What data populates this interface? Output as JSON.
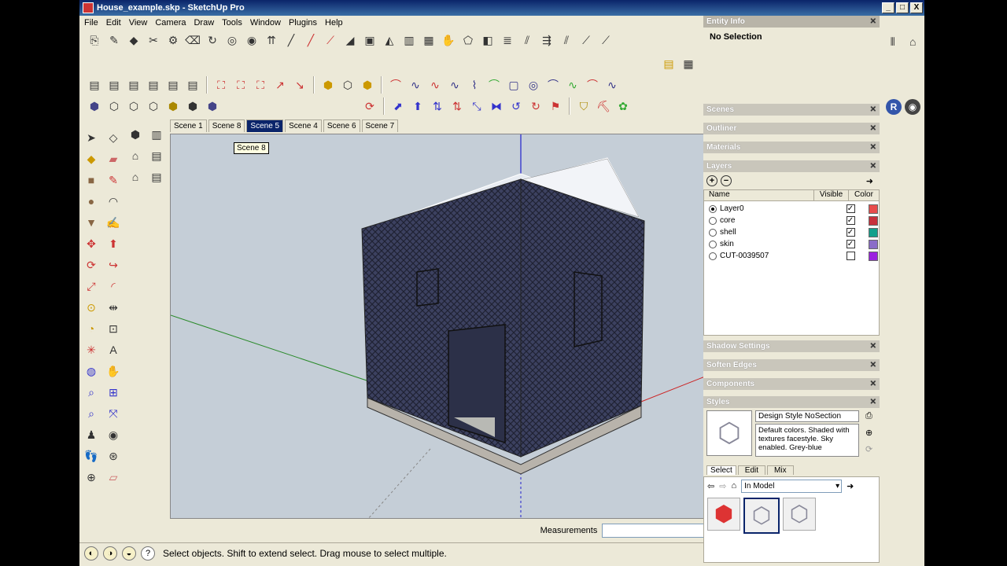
{
  "window": {
    "title": "House_example.skp - SketchUp Pro",
    "min": "_",
    "max": "□",
    "close": "X"
  },
  "menu": [
    "File",
    "Edit",
    "View",
    "Camera",
    "Draw",
    "Tools",
    "Window",
    "Plugins",
    "Help"
  ],
  "scene_tabs": [
    {
      "label": "Scene 1",
      "active": false
    },
    {
      "label": "Scene 8",
      "active": false
    },
    {
      "label": "Scene 5",
      "active": true
    },
    {
      "label": "Scene 4",
      "active": false
    },
    {
      "label": "Scene 6",
      "active": false
    },
    {
      "label": "Scene 7",
      "active": false
    }
  ],
  "tooltip": "Scene 8",
  "measurements_label": "Measurements",
  "status_text": "Select objects. Shift to extend select. Drag mouse to select multiple.",
  "entity_info": {
    "title": "Entity Info",
    "value": "No Selection"
  },
  "trays": {
    "scenes": "Scenes",
    "outliner": "Outliner",
    "materials": "Materials",
    "layers": "Layers",
    "shadow": "Shadow Settings",
    "soften": "Soften Edges",
    "components": "Components",
    "styles": "Styles"
  },
  "layers": {
    "col_name": "Name",
    "col_visible": "Visible",
    "col_color": "Color",
    "rows": [
      {
        "name": "Layer0",
        "active": true,
        "visible": true,
        "color": "#e84c4c"
      },
      {
        "name": "core",
        "active": false,
        "visible": true,
        "color": "#c8303c"
      },
      {
        "name": "shell",
        "active": false,
        "visible": true,
        "color": "#12a08c"
      },
      {
        "name": "skin",
        "active": false,
        "visible": true,
        "color": "#8a6cc8"
      },
      {
        "name": "CUT-0039507",
        "active": false,
        "visible": false,
        "color": "#9b20e0"
      }
    ]
  },
  "styles": {
    "name": "Design Style NoSection",
    "description": "Default colors.  Shaded with textures facestyle.  Sky enabled.  Grey-blue",
    "tabs": [
      "Select",
      "Edit",
      "Mix"
    ],
    "dropdown": "In Model"
  },
  "colors": {
    "titlebar": "#0a246a",
    "sky": "#c5ced7",
    "house": "#3a3f58",
    "ground_slab": "#b8b3ab"
  }
}
